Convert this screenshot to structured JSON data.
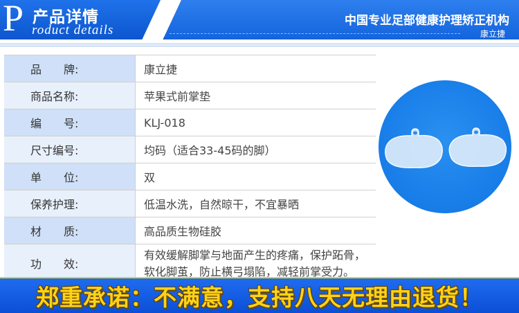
{
  "header": {
    "logo_letter": "P",
    "title_cn": "产品详情",
    "title_en": "roduct details",
    "slogan": "中国专业足部健康护理矫正机构",
    "brand_tag": "康立捷"
  },
  "spec": [
    {
      "label": "品　　牌:",
      "value": "康立捷"
    },
    {
      "label": "商品名称:",
      "value": "苹果式前掌垫"
    },
    {
      "label": "编　　号:",
      "value": "KLJ-018"
    },
    {
      "label": "尺寸编号:",
      "value": "均码（适合33-45码的脚）"
    },
    {
      "label": "单　　位:",
      "value": "双"
    },
    {
      "label": "保养护理:",
      "value": "低温水洗，自然晾干，不宜暴晒"
    },
    {
      "label": "材　　质:",
      "value": "高品质生物硅胶"
    },
    {
      "label": "功　　效:",
      "value": "有效缓解脚掌与地面产生的疼痛，保护跖骨，软化脚茧，防止横弓塌陷，减轻前掌受力。"
    }
  ],
  "footer": {
    "promise": "郑重承诺：不满意，支持八天无理由退货！"
  },
  "colors": {
    "header_blue": "#1464dd",
    "label_bg_dark": "#cfe0f8",
    "label_bg_light": "#e8f0fb",
    "disc_blue": "#1a7fe9",
    "footer_yellow": "#ffd21a"
  }
}
